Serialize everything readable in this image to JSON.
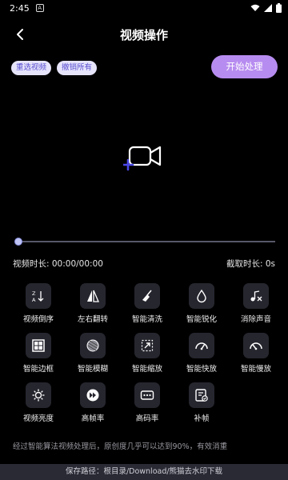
{
  "status": {
    "time": "2:45",
    "notif": "A"
  },
  "header": {
    "title": "视频操作"
  },
  "actions": {
    "reselect": "重选视频",
    "undo_all": "撤销所有",
    "start": "开始处理"
  },
  "timeline": {
    "video_duration": "视频时长: 00:00/00:00",
    "crop_duration": "截取时长: 0s",
    "progress": 0
  },
  "tools": [
    {
      "label": "视频倒序",
      "icon": "reverse-sort-icon"
    },
    {
      "label": "左右翻转",
      "icon": "flip-horizontal-icon"
    },
    {
      "label": "智能清洗",
      "icon": "broom-icon"
    },
    {
      "label": "智能锐化",
      "icon": "droplet-icon"
    },
    {
      "label": "消除声音",
      "icon": "mute-sound-icon"
    },
    {
      "label": "智能边框",
      "icon": "frame-border-icon"
    },
    {
      "label": "智能模糊",
      "icon": "blur-icon"
    },
    {
      "label": "智能缩放",
      "icon": "scale-arrows-icon"
    },
    {
      "label": "智能快放",
      "icon": "speed-fast-icon"
    },
    {
      "label": "智能慢放",
      "icon": "speed-slow-icon"
    },
    {
      "label": "视频亮度",
      "icon": "brightness-icon"
    },
    {
      "label": "高帧率",
      "icon": "fast-forward-icon"
    },
    {
      "label": "高码率",
      "icon": "bitrate-icon"
    },
    {
      "label": "补帧",
      "icon": "frame-fill-icon"
    }
  ],
  "note": "经过智能算法视频处理后，原创度几乎可以达到90%，有效消重",
  "footer": {
    "save_path": "保存路径：根目录/Download/熊猫去水印下载"
  }
}
